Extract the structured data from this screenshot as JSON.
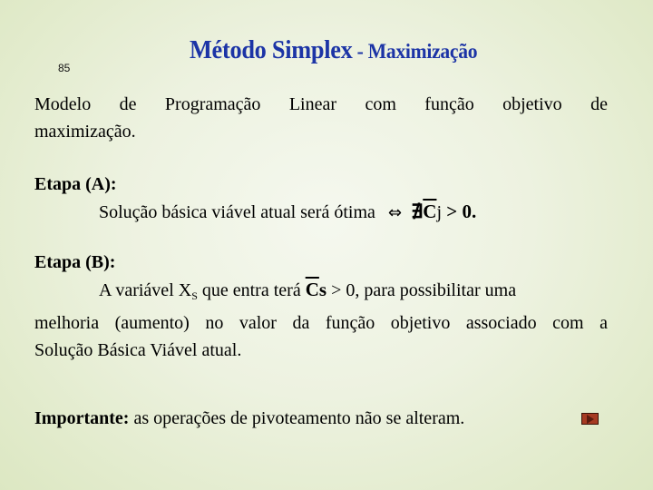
{
  "slide": {
    "number": "85",
    "title_main": "Método Simplex",
    "title_sub": " - Maximização"
  },
  "intro": {
    "line1_words": [
      "Modelo",
      "de",
      "Programação",
      "Linear",
      "com",
      "função",
      "objetivo",
      "de"
    ],
    "line2": "maximização."
  },
  "stage_a": {
    "heading": "Etapa (A):",
    "text": "Solução básica viável atual será ótima",
    "iff_symbol": "⇔",
    "not_exists_symbol": "∄",
    "coef": "C",
    "coef_index": "j",
    "relation": " > ",
    "value": "0."
  },
  "stage_b": {
    "heading": "Etapa (B):",
    "text_before": "A variável X",
    "var_subscript": "S",
    "text_mid": " que entra terá ",
    "coef": "C",
    "coef_index": "s",
    "text_after": " > 0, para possibilitar uma",
    "line2_words": [
      "melhoria",
      "(aumento)",
      "no",
      "valor",
      "da",
      "função",
      "objetivo",
      "associado",
      "com",
      "a"
    ],
    "line3": "Solução Básica Viável atual."
  },
  "note": {
    "label": "Importante:",
    "text": " as operações de pivoteamento não se alteram."
  },
  "nav": {
    "next_icon": "play-triangle-icon",
    "colors": {
      "button": "#a63a22",
      "title": "#1c34a6"
    }
  }
}
